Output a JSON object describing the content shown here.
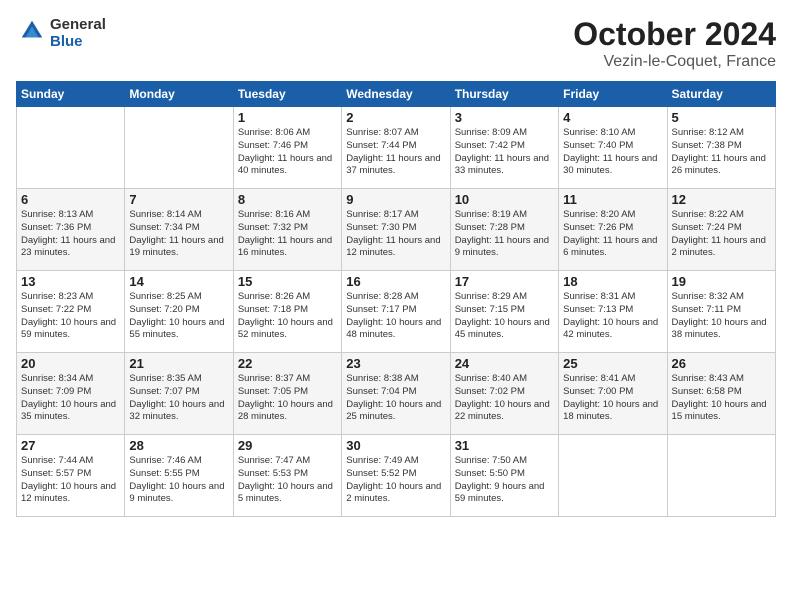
{
  "header": {
    "logo_general": "General",
    "logo_blue": "Blue",
    "month_title": "October 2024",
    "location": "Vezin-le-Coquet, France"
  },
  "days_of_week": [
    "Sunday",
    "Monday",
    "Tuesday",
    "Wednesday",
    "Thursday",
    "Friday",
    "Saturday"
  ],
  "weeks": [
    [
      {
        "day": "",
        "info": ""
      },
      {
        "day": "",
        "info": ""
      },
      {
        "day": "1",
        "info": "Sunrise: 8:06 AM\nSunset: 7:46 PM\nDaylight: 11 hours and 40 minutes."
      },
      {
        "day": "2",
        "info": "Sunrise: 8:07 AM\nSunset: 7:44 PM\nDaylight: 11 hours and 37 minutes."
      },
      {
        "day": "3",
        "info": "Sunrise: 8:09 AM\nSunset: 7:42 PM\nDaylight: 11 hours and 33 minutes."
      },
      {
        "day": "4",
        "info": "Sunrise: 8:10 AM\nSunset: 7:40 PM\nDaylight: 11 hours and 30 minutes."
      },
      {
        "day": "5",
        "info": "Sunrise: 8:12 AM\nSunset: 7:38 PM\nDaylight: 11 hours and 26 minutes."
      }
    ],
    [
      {
        "day": "6",
        "info": "Sunrise: 8:13 AM\nSunset: 7:36 PM\nDaylight: 11 hours and 23 minutes."
      },
      {
        "day": "7",
        "info": "Sunrise: 8:14 AM\nSunset: 7:34 PM\nDaylight: 11 hours and 19 minutes."
      },
      {
        "day": "8",
        "info": "Sunrise: 8:16 AM\nSunset: 7:32 PM\nDaylight: 11 hours and 16 minutes."
      },
      {
        "day": "9",
        "info": "Sunrise: 8:17 AM\nSunset: 7:30 PM\nDaylight: 11 hours and 12 minutes."
      },
      {
        "day": "10",
        "info": "Sunrise: 8:19 AM\nSunset: 7:28 PM\nDaylight: 11 hours and 9 minutes."
      },
      {
        "day": "11",
        "info": "Sunrise: 8:20 AM\nSunset: 7:26 PM\nDaylight: 11 hours and 6 minutes."
      },
      {
        "day": "12",
        "info": "Sunrise: 8:22 AM\nSunset: 7:24 PM\nDaylight: 11 hours and 2 minutes."
      }
    ],
    [
      {
        "day": "13",
        "info": "Sunrise: 8:23 AM\nSunset: 7:22 PM\nDaylight: 10 hours and 59 minutes."
      },
      {
        "day": "14",
        "info": "Sunrise: 8:25 AM\nSunset: 7:20 PM\nDaylight: 10 hours and 55 minutes."
      },
      {
        "day": "15",
        "info": "Sunrise: 8:26 AM\nSunset: 7:18 PM\nDaylight: 10 hours and 52 minutes."
      },
      {
        "day": "16",
        "info": "Sunrise: 8:28 AM\nSunset: 7:17 PM\nDaylight: 10 hours and 48 minutes."
      },
      {
        "day": "17",
        "info": "Sunrise: 8:29 AM\nSunset: 7:15 PM\nDaylight: 10 hours and 45 minutes."
      },
      {
        "day": "18",
        "info": "Sunrise: 8:31 AM\nSunset: 7:13 PM\nDaylight: 10 hours and 42 minutes."
      },
      {
        "day": "19",
        "info": "Sunrise: 8:32 AM\nSunset: 7:11 PM\nDaylight: 10 hours and 38 minutes."
      }
    ],
    [
      {
        "day": "20",
        "info": "Sunrise: 8:34 AM\nSunset: 7:09 PM\nDaylight: 10 hours and 35 minutes."
      },
      {
        "day": "21",
        "info": "Sunrise: 8:35 AM\nSunset: 7:07 PM\nDaylight: 10 hours and 32 minutes."
      },
      {
        "day": "22",
        "info": "Sunrise: 8:37 AM\nSunset: 7:05 PM\nDaylight: 10 hours and 28 minutes."
      },
      {
        "day": "23",
        "info": "Sunrise: 8:38 AM\nSunset: 7:04 PM\nDaylight: 10 hours and 25 minutes."
      },
      {
        "day": "24",
        "info": "Sunrise: 8:40 AM\nSunset: 7:02 PM\nDaylight: 10 hours and 22 minutes."
      },
      {
        "day": "25",
        "info": "Sunrise: 8:41 AM\nSunset: 7:00 PM\nDaylight: 10 hours and 18 minutes."
      },
      {
        "day": "26",
        "info": "Sunrise: 8:43 AM\nSunset: 6:58 PM\nDaylight: 10 hours and 15 minutes."
      }
    ],
    [
      {
        "day": "27",
        "info": "Sunrise: 7:44 AM\nSunset: 5:57 PM\nDaylight: 10 hours and 12 minutes."
      },
      {
        "day": "28",
        "info": "Sunrise: 7:46 AM\nSunset: 5:55 PM\nDaylight: 10 hours and 9 minutes."
      },
      {
        "day": "29",
        "info": "Sunrise: 7:47 AM\nSunset: 5:53 PM\nDaylight: 10 hours and 5 minutes."
      },
      {
        "day": "30",
        "info": "Sunrise: 7:49 AM\nSunset: 5:52 PM\nDaylight: 10 hours and 2 minutes."
      },
      {
        "day": "31",
        "info": "Sunrise: 7:50 AM\nSunset: 5:50 PM\nDaylight: 9 hours and 59 minutes."
      },
      {
        "day": "",
        "info": ""
      },
      {
        "day": "",
        "info": ""
      }
    ]
  ]
}
